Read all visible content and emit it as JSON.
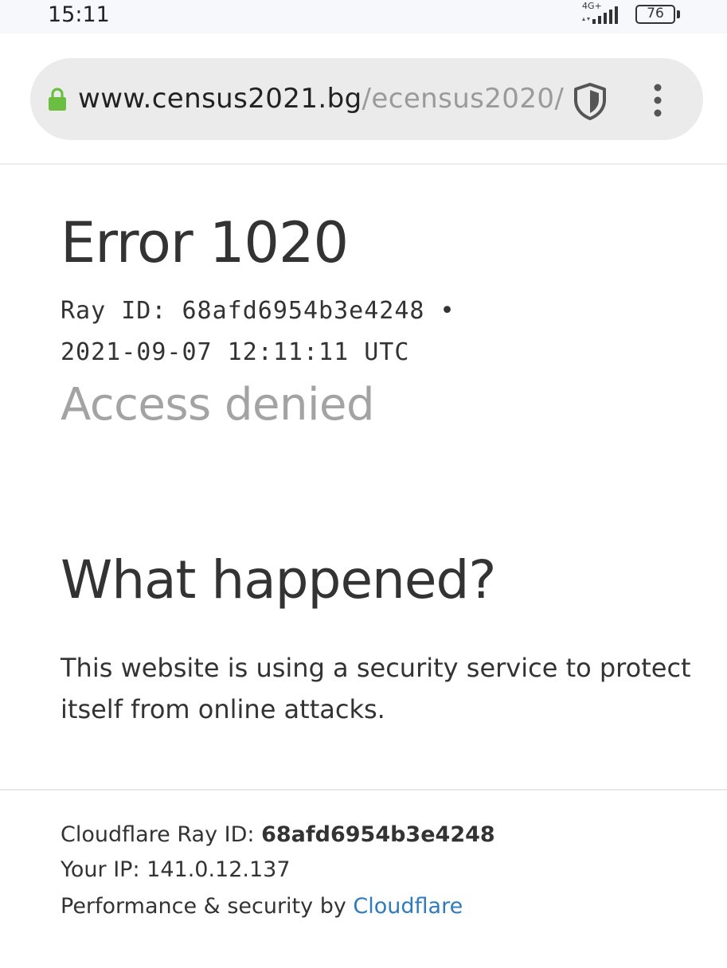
{
  "status_bar": {
    "time": "15:11",
    "network": "4G+",
    "battery": "76"
  },
  "browser": {
    "url_domain": "www.census2021.bg",
    "url_path": "/ecensus2020/",
    "icons": {
      "lock": "lock-icon",
      "shield": "shield-icon",
      "menu": "more-vert-icon"
    },
    "lock_color": "#6abf40"
  },
  "page": {
    "error_title": "Error 1020",
    "ray_line_1": "Ray ID: 68afd6954b3e4248 •",
    "ray_line_2": "2021-09-07 12:11:11 UTC",
    "access_denied": "Access denied",
    "what_happened_heading": "What happened?",
    "explanation": "This website is using a security service to protect itself from online attacks."
  },
  "footer": {
    "ray_label": "Cloudflare Ray ID: ",
    "ray_id": "68afd6954b3e4248",
    "ip_label": "Your IP: ",
    "ip": "141.0.12.137",
    "perf_label": "Performance & security by ",
    "cloudflare_link": "Cloudflare",
    "link_color": "#2f7bbf"
  }
}
